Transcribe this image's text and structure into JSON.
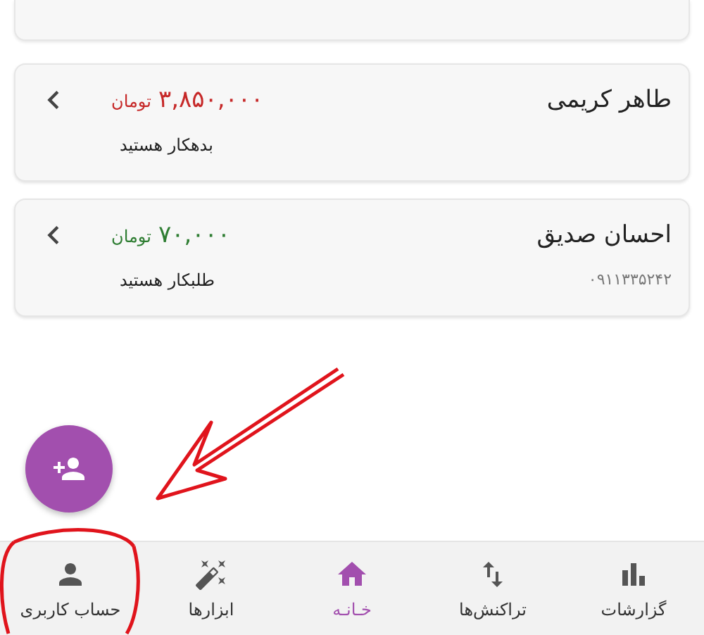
{
  "contacts": [
    {
      "name": "طاهر کریمی",
      "amount": "۳,۸۵۰,۰۰۰",
      "currency": "تومان",
      "kind": "debt",
      "status": "بدهکار هستید"
    },
    {
      "name": "احسان صدیق",
      "amount": "۷۰,۰۰۰",
      "currency": "تومان",
      "kind": "credit",
      "status": "طلبکار هستید",
      "phone": "۰۹۱۱۳۳۵۲۴۲"
    }
  ],
  "nav": [
    {
      "label": "گزارشات",
      "kind": "reports",
      "selected": false
    },
    {
      "label": "تراکنش‌ها",
      "kind": "transactions",
      "selected": false
    },
    {
      "label": "خـانـه",
      "kind": "home",
      "selected": true
    },
    {
      "label": "ابزارها",
      "kind": "tools",
      "selected": false
    },
    {
      "label": "حساب کاربری",
      "kind": "account",
      "selected": false
    }
  ]
}
